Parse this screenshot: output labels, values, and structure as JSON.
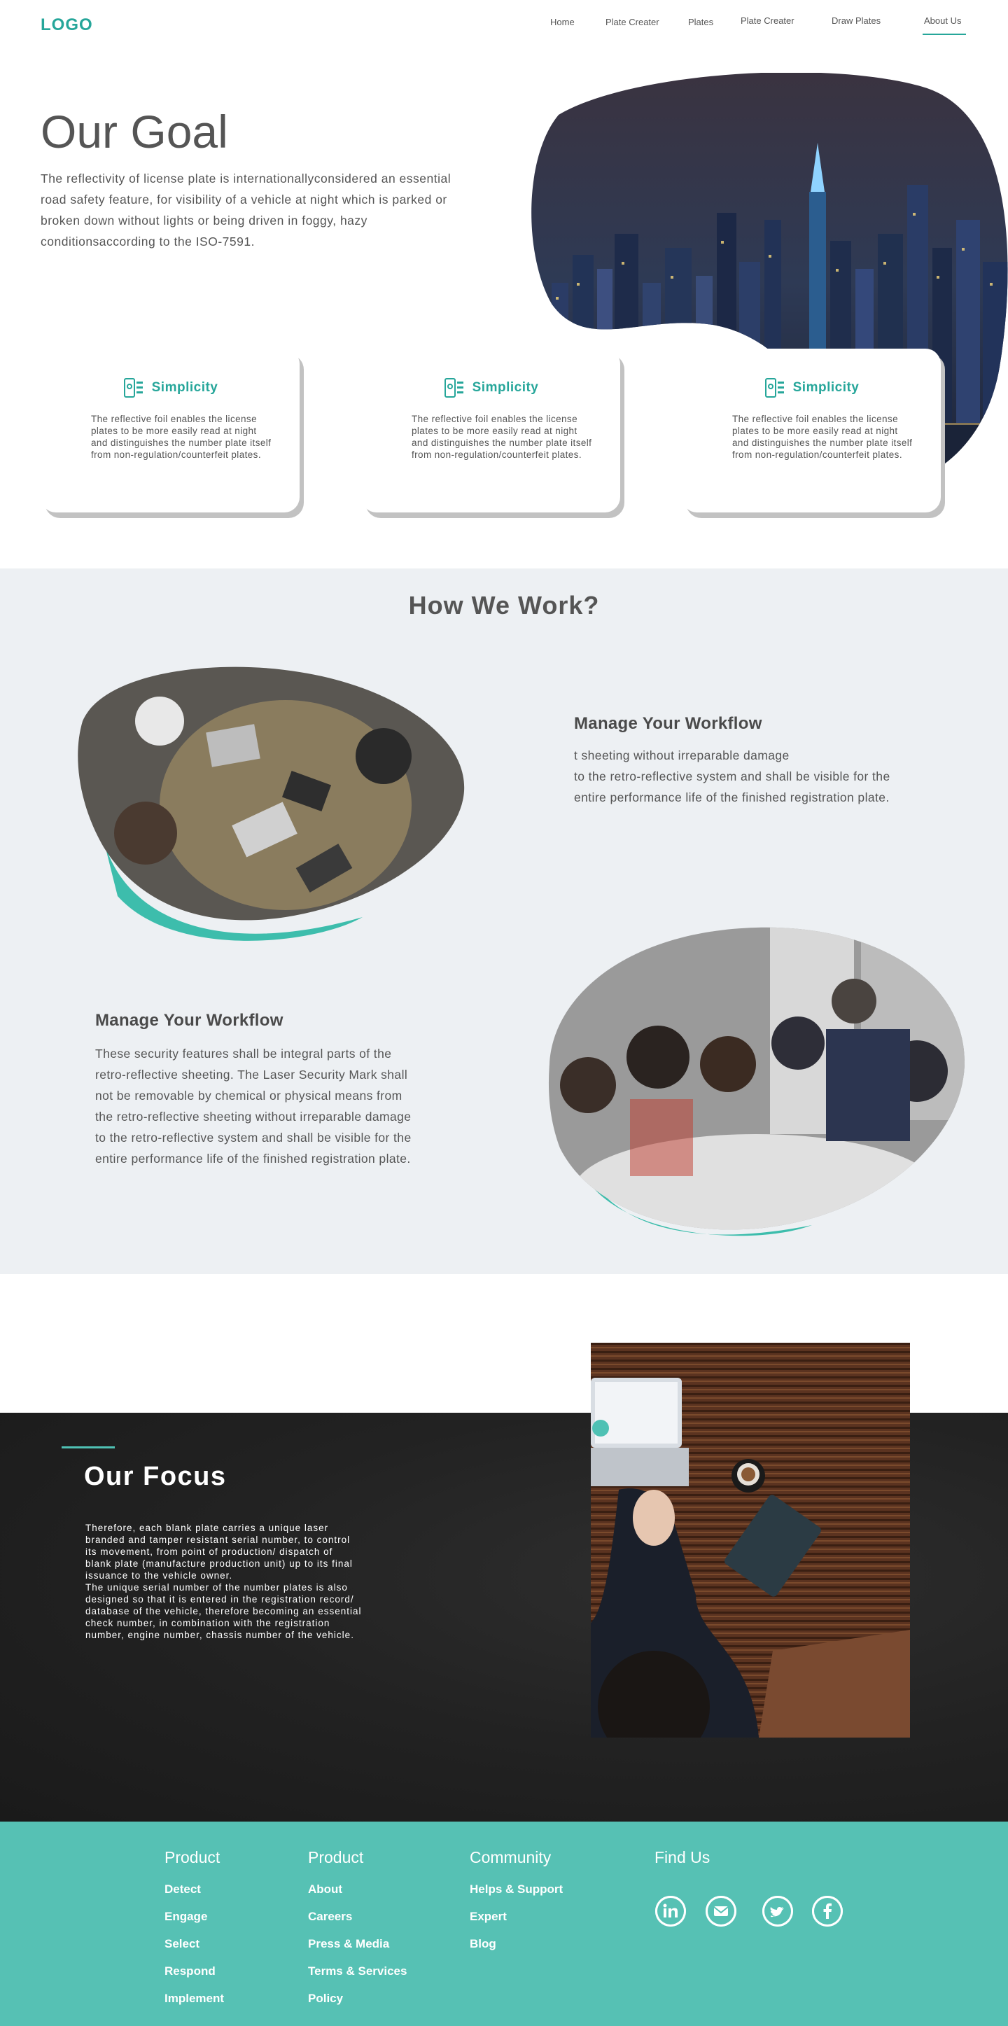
{
  "nav": {
    "logo": "LOGO",
    "items": [
      "Home",
      "Plate Creater",
      "Plates",
      "Plate Creater",
      "Draw Plates",
      "About Us"
    ]
  },
  "hero": {
    "title": "Our Goal",
    "text": "The reflectivity of license plate is internationallyconsidered an essential road safety feature, for visibility of a vehicle at night which is parked or broken down without lights or being driven in foggy, hazy conditionsaccording to the ISO-7591."
  },
  "cards": [
    {
      "title": "Simplicity",
      "text": "The reflective foil enables the license plates to be more easily read at night and distinguishes the number plate itself from non-regulation/counterfeit plates.",
      "icon": "settings-phone-icon"
    },
    {
      "title": "Simplicity",
      "text": "The reflective foil enables the license plates to be more easily read at night and distinguishes the number plate itself from non-regulation/counterfeit plates.",
      "icon": "settings-phone-icon"
    },
    {
      "title": "Simplicity",
      "text": "The reflective foil enables the license plates to be more easily read at night and distinguishes the number plate itself from non-regulation/counterfeit plates.",
      "icon": "settings-phone-icon"
    }
  ],
  "how": {
    "title": "How We Work?",
    "block1": {
      "title": "Manage Your Workflow",
      "lines": [
        "t sheeting without irreparable damage",
        "to the retro-reflective system and shall be visible for the",
        "entire performance life of the finished registration plate."
      ]
    },
    "block2": {
      "title": "Manage Your Workflow",
      "lines": [
        "These security features shall be integral parts of the",
        "retro-reflective sheeting. The Laser Security Mark shall",
        "not be removable by chemical or physical means from",
        "the retro-reflective sheeting without irreparable damage",
        "to the retro-reflective system and shall be visible for the",
        "entire performance life of the finished registration plate."
      ]
    }
  },
  "focus": {
    "title": "Our Focus",
    "lines": [
      "Therefore, each blank plate carries a unique laser",
      "branded and tamper resistant serial number, to control",
      "its movement, from point of production/ dispatch of",
      "blank plate (manufacture production unit) up to its final",
      "issuance to the vehicle owner.",
      "The unique serial number of the number plates is also",
      "designed so that it is entered in the registration record/",
      "database of the vehicle, therefore becoming an essential",
      "check number, in combination with the registration",
      "number, engine number, chassis number of the vehicle."
    ]
  },
  "footer": {
    "columns": [
      {
        "heading": "Product",
        "links": [
          "Detect",
          "Engage",
          "Select",
          "Respond",
          "Implement"
        ]
      },
      {
        "heading": "Product",
        "links": [
          "About",
          "Careers",
          "Press & Media",
          "Terms & Services",
          "Policy"
        ]
      },
      {
        "heading": "Community",
        "links": [
          "Helps & Support",
          "Expert",
          "Blog"
        ]
      }
    ],
    "find_us": "Find Us",
    "social": [
      "linkedin-icon",
      "mail-icon",
      "twitter-icon",
      "facebook-icon"
    ]
  },
  "colors": {
    "accent": "#26a69a",
    "footer": "#56c1b4",
    "section_bg": "#edf0f3"
  }
}
